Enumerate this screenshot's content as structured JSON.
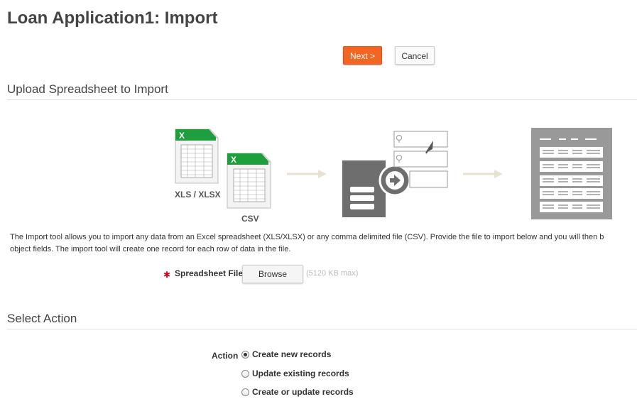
{
  "header": {
    "title": "Loan Application1: Import"
  },
  "toolbar": {
    "next_label": "Next >",
    "cancel_label": "Cancel"
  },
  "upload": {
    "section_title": "Upload Spreadsheet to Import",
    "xls_label": "XLS / XLSX",
    "csv_label": "CSV",
    "description_line1": "The Import tool allows you to import any data from an Excel spreadsheet (XLS/XLSX) or any comma delimited file (CSV). Provide the file to import below and you will then b",
    "description_line2": "object fields. The import tool will create one record for each row of data in the file.",
    "field_label": "Spreadsheet File",
    "browse_label": "Browse",
    "max_hint": "(5120 KB max)"
  },
  "action": {
    "section_title": "Select Action",
    "label": "Action",
    "options": [
      {
        "label": "Create new records",
        "checked": true
      },
      {
        "label": "Update existing records",
        "checked": false
      },
      {
        "label": "Create or update records",
        "checked": false
      }
    ]
  },
  "colors": {
    "accent": "#f26522",
    "excel_green": "#1e9e3c",
    "gray_panel": "#6e6e6e"
  },
  "icons": [
    "excel-xls-icon",
    "excel-csv-icon",
    "arrow-right-icon",
    "database-import-icon",
    "mapping-fields-icon",
    "records-table-icon"
  ]
}
